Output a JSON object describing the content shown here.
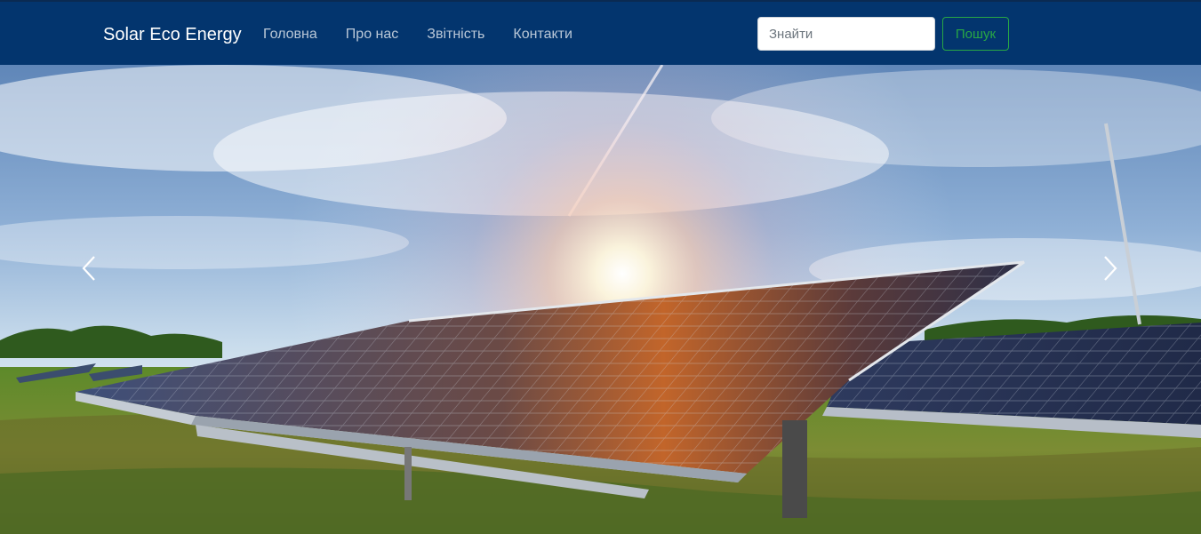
{
  "navbar": {
    "brand": "Solar Eco Energy",
    "links": [
      {
        "label": "Головна"
      },
      {
        "label": "Про нас"
      },
      {
        "label": "Звітність"
      },
      {
        "label": "Контакти"
      }
    ],
    "search": {
      "placeholder": "Знайти",
      "button_label": "Пошук"
    }
  },
  "colors": {
    "navbar_bg": "#03356e",
    "search_button": "#28a745"
  },
  "carousel": {
    "prev_icon": "chevron-left-icon",
    "next_icon": "chevron-right-icon"
  }
}
